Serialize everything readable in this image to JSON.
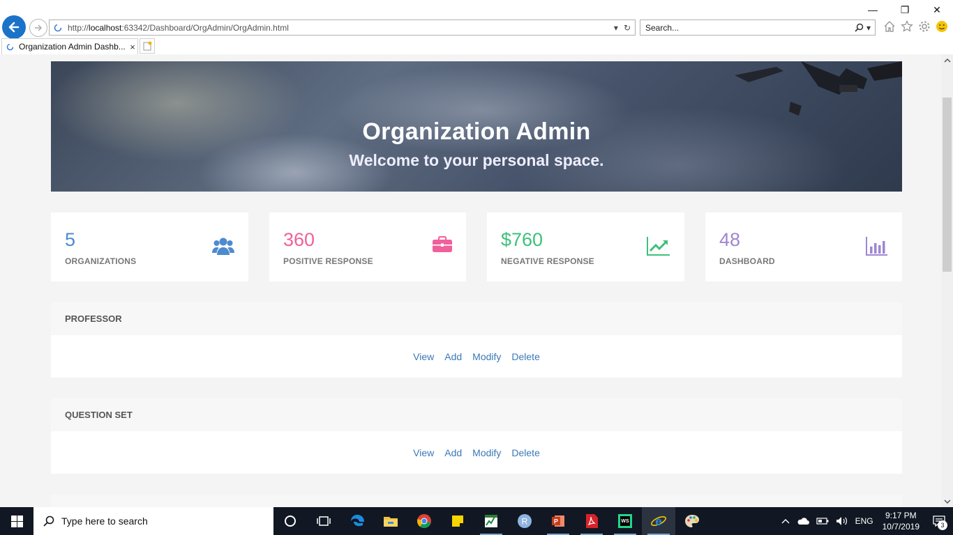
{
  "browser": {
    "url_prefix": "http://",
    "url_host": "localhost",
    "url_rest": ":63342/Dashboard/OrgAdmin/OrgAdmin.html",
    "search_placeholder": "Search...",
    "tab_title": "Organization Admin Dashb...",
    "tab_close": "×",
    "minimize": "—",
    "restore": "❐",
    "close": "✕"
  },
  "hero": {
    "title": "Organization Admin",
    "subtitle": "Welcome to your personal space."
  },
  "stats": [
    {
      "value": "5",
      "label": "ORGANIZATIONS",
      "color": "#4d8ad0",
      "icon": "users-icon"
    },
    {
      "value": "360",
      "label": "POSITIVE RESPONSE",
      "color": "#f0609a",
      "icon": "briefcase-icon"
    },
    {
      "value": "$760",
      "label": "NEGATIVE RESPONSE",
      "color": "#3ec07a",
      "icon": "trend-up-icon"
    },
    {
      "value": "48",
      "label": "DASHBOARD",
      "color": "#9f86d1",
      "icon": "bar-chart-icon"
    }
  ],
  "panels": [
    {
      "title": "PROFESSOR",
      "actions": {
        "view": "View",
        "add": "Add",
        "modify": "Modify",
        "delete": "Delete"
      }
    },
    {
      "title": "QUESTION SET",
      "actions": {
        "view": "View",
        "add": "Add",
        "modify": "Modify",
        "delete": "Delete"
      }
    }
  ],
  "taskbar": {
    "search_text": "Type here to search",
    "language": "ENG",
    "time": "9:17 PM",
    "date": "10/7/2019",
    "notification_count": "3",
    "apps": [
      "task-view-icon",
      "edge-icon",
      "file-explorer-icon",
      "chrome-icon",
      "sticky-notes-icon",
      "project-icon",
      "r-icon",
      "powerpoint-icon",
      "acrobat-icon",
      "webstorm-icon",
      "internet-explorer-icon",
      "paint-icon"
    ]
  }
}
